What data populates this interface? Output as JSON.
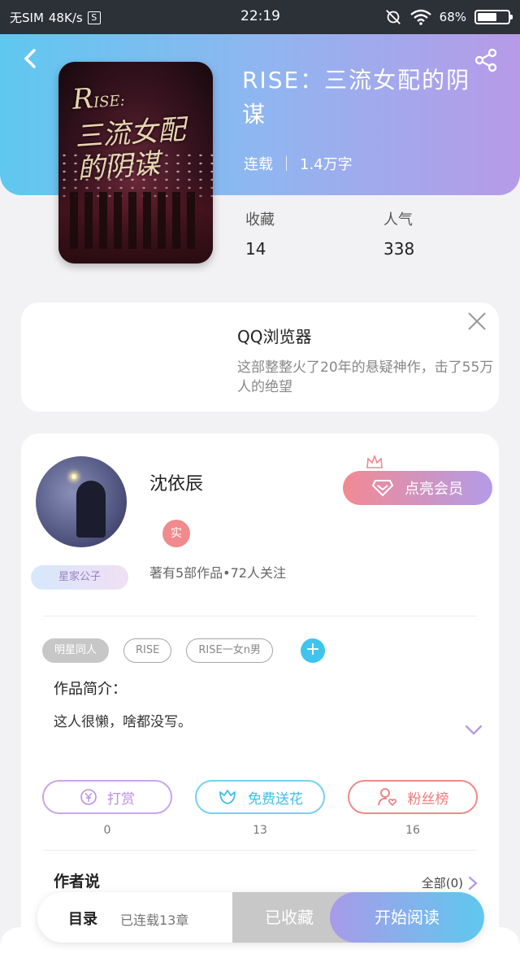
{
  "status_bar": {
    "carrier": "无SIM",
    "speed": "48K/s",
    "s_badge": "S",
    "time": "22:19",
    "battery": "68%",
    "battery_level": 0.68
  },
  "book": {
    "title": "RISE：三流女配的阴谋",
    "status": "连载",
    "word_count": "1.4万字",
    "cover_text": "RISE:三流女配的阴谋",
    "stats": [
      {
        "label": "收藏",
        "value": "14"
      },
      {
        "label": "人气",
        "value": "338"
      }
    ]
  },
  "ad": {
    "title": "QQ浏览器",
    "description": "这部整整火了20年的悬疑神作，击了55万人的绝望"
  },
  "author": {
    "name": "沈依辰",
    "real_badge": "实",
    "level_badge": "星家公子",
    "stats": "著有5部作品•72人关注",
    "vip_button": "点亮会员"
  },
  "tags": [
    "明星同人",
    "RISE",
    "RISE一女n男"
  ],
  "intro": {
    "label": "作品简介：",
    "text": "这人很懒，啥都没写。"
  },
  "actions": [
    {
      "label": "打赏",
      "count": "0"
    },
    {
      "label": "免费送花",
      "count": "13"
    },
    {
      "label": "粉丝榜",
      "count": "16"
    }
  ],
  "author_says": {
    "label": "作者说",
    "all": "全部(0)"
  },
  "bottom_bar": {
    "toc": "目录",
    "toc_sub": "已连载13章",
    "favorited": "已收藏",
    "start_reading": "开始阅读"
  }
}
